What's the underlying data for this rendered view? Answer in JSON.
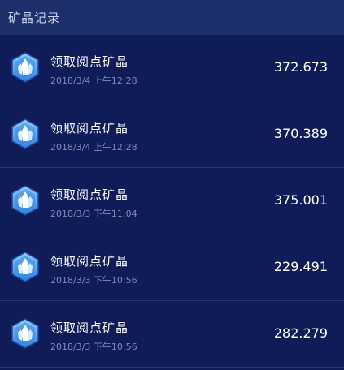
{
  "header": {
    "title": "矿晶记录"
  },
  "colors": {
    "background": "#0f1c57",
    "header_background": "#1d2f6b",
    "divider": "#25367a",
    "title_text": "#ffffff",
    "time_text": "#7f8cb7"
  },
  "records": [
    {
      "icon": "crystal-icon",
      "title": "领取阅点矿晶",
      "time": "2018/3/4 上午12:28",
      "amount": "372.673"
    },
    {
      "icon": "crystal-icon",
      "title": "领取阅点矿晶",
      "time": "2018/3/4 上午12:28",
      "amount": "370.389"
    },
    {
      "icon": "crystal-icon",
      "title": "领取阅点矿晶",
      "time": "2018/3/3 下午11:04",
      "amount": "375.001"
    },
    {
      "icon": "crystal-icon",
      "title": "领取阅点矿晶",
      "time": "2018/3/3 下午10:56",
      "amount": "229.491"
    },
    {
      "icon": "crystal-icon",
      "title": "领取阅点矿晶",
      "time": "2018/3/3 下午10:56",
      "amount": "282.279"
    }
  ]
}
